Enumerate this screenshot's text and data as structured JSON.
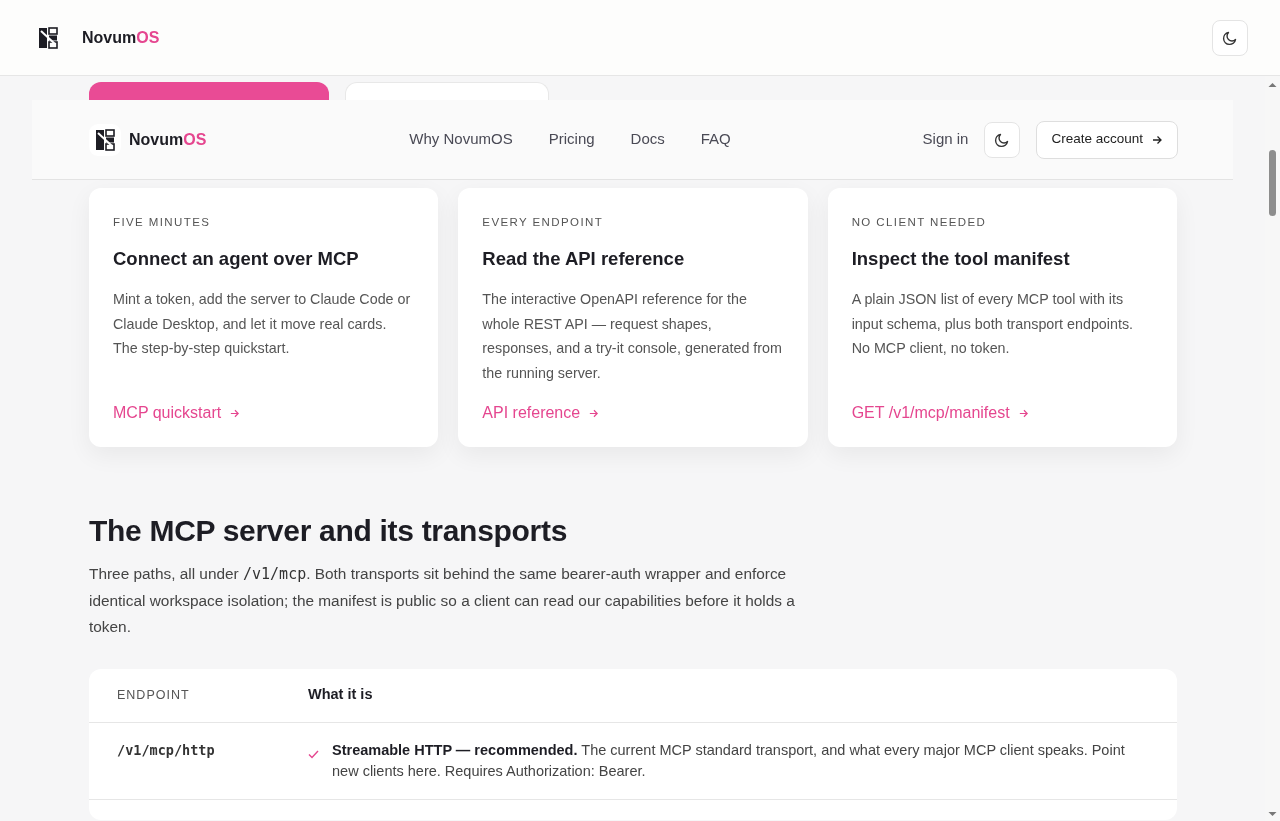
{
  "top_bar": {
    "brand_main": "Novum",
    "brand_accent": "OS"
  },
  "nav": {
    "brand_main": "Novum",
    "brand_accent": "OS",
    "links": [
      "Why NovumOS",
      "Pricing",
      "Docs",
      "FAQ"
    ],
    "sign_in": "Sign in",
    "cta": "Create account"
  },
  "cards": [
    {
      "eyebrow": "FIVE MINUTES",
      "title": "Connect an agent over MCP",
      "body": "Mint a token, add the server to Claude Code or Claude Desktop, and let it move real cards. The step-by-step quickstart.",
      "link": "MCP quickstart"
    },
    {
      "eyebrow": "EVERY ENDPOINT",
      "title": "Read the API reference",
      "body": "The interactive OpenAPI reference for the whole REST API — request shapes, responses, and a try-it console, generated from the running server.",
      "link": "API reference"
    },
    {
      "eyebrow": "NO CLIENT NEEDED",
      "title": "Inspect the tool manifest",
      "body": "A plain JSON list of every MCP tool with its input schema, plus both transport endpoints. No MCP client, no token.",
      "link": "GET /v1/mcp/manifest"
    }
  ],
  "section": {
    "heading": "The MCP server and its transports",
    "intro": [
      {
        "kind": "text",
        "text": "Three paths, all under "
      },
      {
        "kind": "code",
        "text": "/v1/mcp"
      },
      {
        "kind": "text",
        "text": ". Both transports sit behind the same bearer-auth wrapper and enforce identical workspace isolation; the manifest is public so a client can read our capabilities before it holds a token."
      }
    ]
  },
  "table": {
    "columns": [
      "ENDPOINT",
      "What it is"
    ],
    "rows": [
      {
        "endpoint": "/v1/mcp/http",
        "checked": true,
        "description": "**Streamable HTTP — recommended.** The current MCP standard transport, and what every major MCP client speaks. Point new clients here. Requires Authorization: Bearer."
      }
    ]
  }
}
